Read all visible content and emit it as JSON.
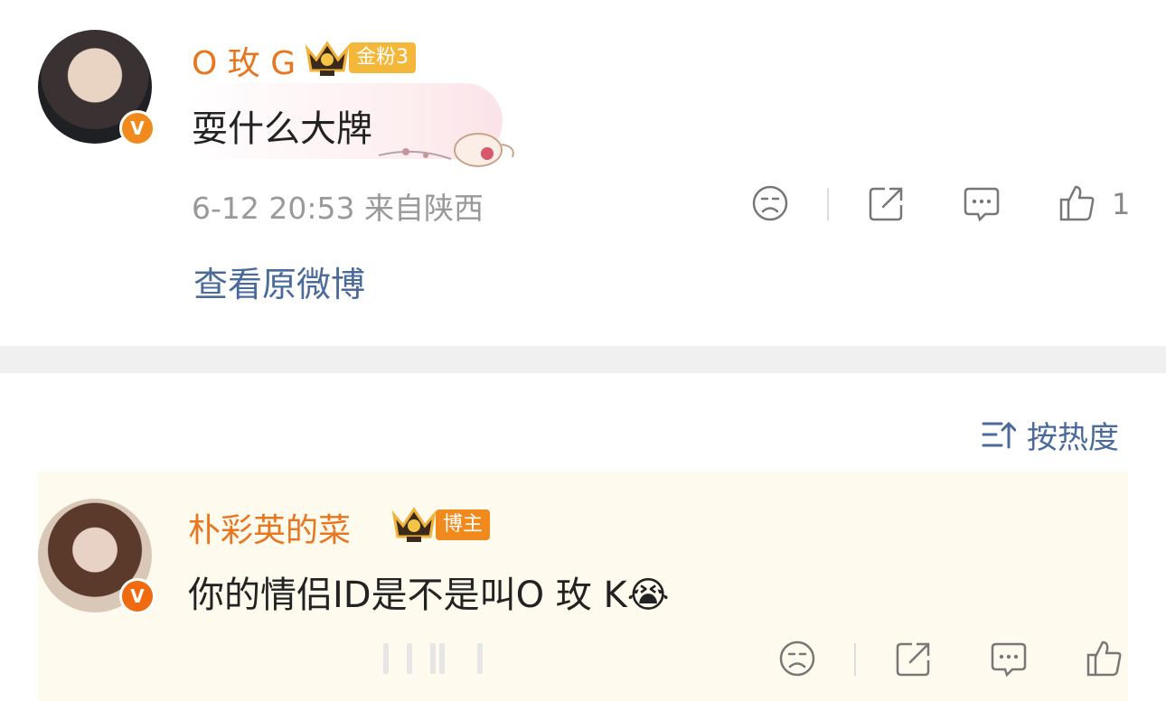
{
  "comment1": {
    "username": "O 玫 G",
    "badge": "金粉3",
    "text": "耍什么大牌",
    "time": "6-12 20:53",
    "location": "来自陕西",
    "like_count": "1",
    "view_original": "查看原微博"
  },
  "sort": {
    "label": "按热度"
  },
  "comment2": {
    "username": "朴彩英的菜",
    "badge": "博主",
    "text": "你的情侣ID是不是叫O 玫 K",
    "emoji": "😭"
  },
  "colors": {
    "username": "#e8761f",
    "link": "#4a6a9c",
    "badge_gold": "#f5b73a",
    "badge_orange": "#f08a1c",
    "highlight_bg": "#fefaee"
  },
  "icons": [
    "dislike-face-icon",
    "share-icon",
    "comment-icon",
    "thumbs-up-icon",
    "sort-icon",
    "crown-icon",
    "verified-v-icon"
  ]
}
